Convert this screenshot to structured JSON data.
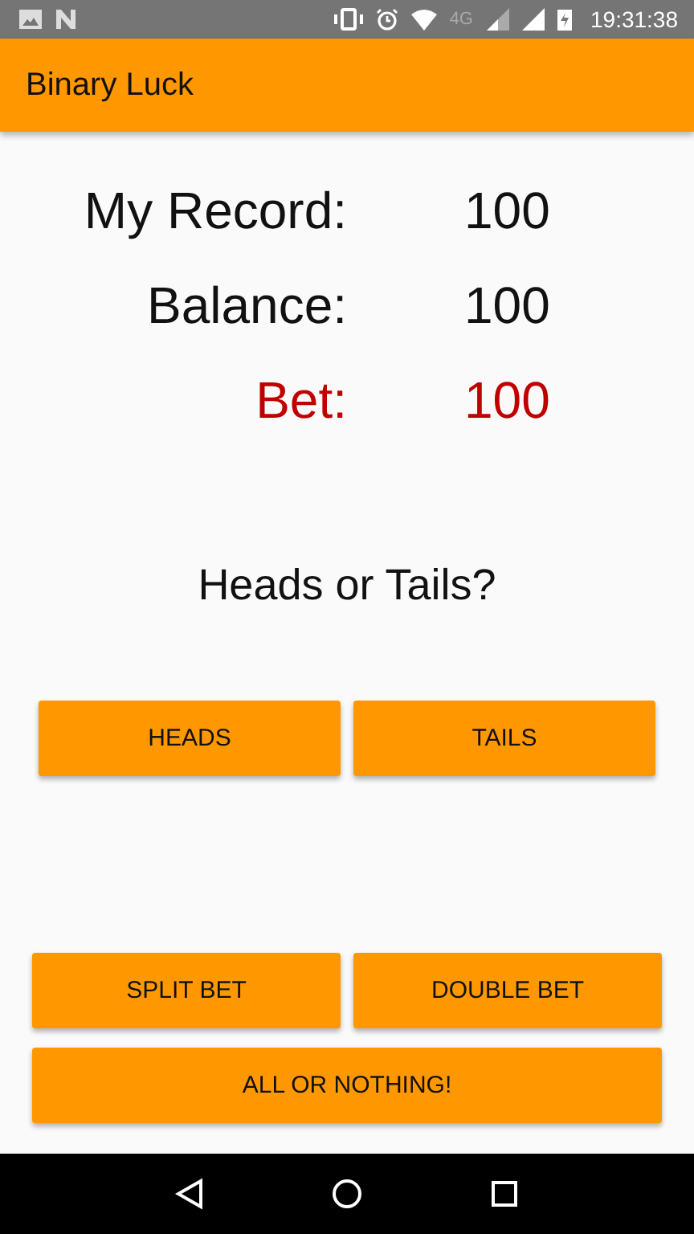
{
  "status_bar": {
    "network": "4G",
    "time": "19:31:38"
  },
  "app_bar": {
    "title": "Binary Luck"
  },
  "stats": [
    {
      "label": "My Record:",
      "value": "100",
      "kind": "normal"
    },
    {
      "label": "Balance:",
      "value": "100",
      "kind": "normal"
    },
    {
      "label": "Bet:",
      "value": "100",
      "kind": "highlight"
    }
  ],
  "prompt": "Heads or Tails?",
  "choice_buttons": [
    "HEADS",
    "TAILS"
  ],
  "bet_buttons": [
    "SPLIT BET",
    "DOUBLE BET"
  ],
  "wide_button": "ALL OR NOTHING!"
}
